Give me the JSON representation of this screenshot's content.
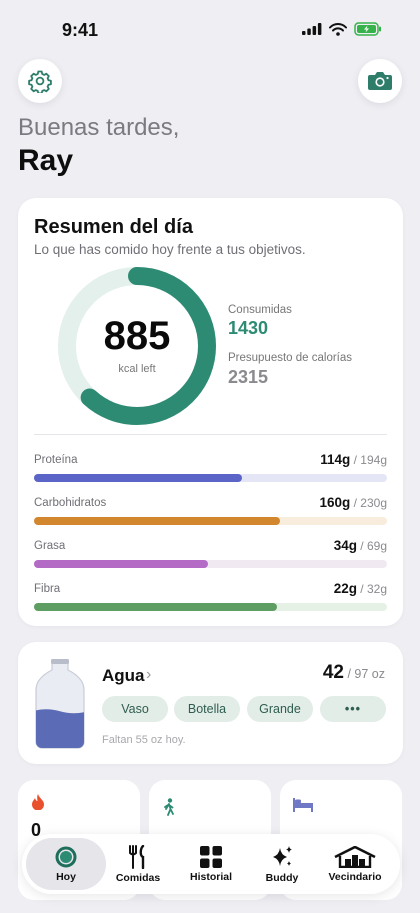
{
  "status_bar": {
    "time": "9:41"
  },
  "header": {
    "greeting": "Buenas tardes,",
    "user_name": "Ray"
  },
  "summary": {
    "title": "Resumen del día",
    "subtitle": "Lo que has comido hoy frente a tus objetivos.",
    "remaining_value": "885",
    "remaining_label": "kcal left",
    "consumed_label": "Consumidas",
    "consumed_value": "1430",
    "budget_label": "Presupuesto de calorías",
    "budget_value": "2315",
    "ring_fraction": 0.618,
    "macros": [
      {
        "name": "Proteína",
        "value": "114g",
        "goal": " / 194g",
        "fraction": 0.588,
        "color": "#5B64C7",
        "track": "#E4E6F6"
      },
      {
        "name": "Carbohidratos",
        "value": "160g",
        "goal": " / 230g",
        "fraction": 0.696,
        "color": "#D2862E",
        "track": "#F8ECDC"
      },
      {
        "name": "Grasa",
        "value": "34g",
        "goal": " / 69g",
        "fraction": 0.493,
        "color": "#B36BC6",
        "track": "#F0E9F2"
      },
      {
        "name": "Fibra",
        "value": "22g",
        "goal": " / 32g",
        "fraction": 0.688,
        "color": "#5E9E62",
        "track": "#E6F1E6"
      }
    ]
  },
  "water": {
    "title": "Agua",
    "chevron": "›",
    "amount": "42",
    "goal": " / 97 oz",
    "level_fraction": 0.45,
    "buttons": [
      "Vaso",
      "Botella",
      "Grande",
      "•••"
    ],
    "footer": "Faltan 55 oz hoy."
  },
  "mini_cards": [
    {
      "icon": "flame-icon",
      "value": "0"
    },
    {
      "icon": "walking-icon",
      "value": ""
    },
    {
      "icon": "bed-icon",
      "value": ""
    }
  ],
  "tabs": [
    {
      "label": "Hoy",
      "icon": "ring-icon",
      "active": true
    },
    {
      "label": "Comidas",
      "icon": "fork-knife-icon",
      "active": false
    },
    {
      "label": "Historial",
      "icon": "grid-icon",
      "active": false
    },
    {
      "label": "Buddy",
      "icon": "sparkles-icon",
      "active": false
    },
    {
      "label": "Vecindario",
      "icon": "house-icon",
      "active": false
    }
  ],
  "colors": {
    "accent_green": "#2E8B73",
    "background": "#EEEEF3"
  }
}
